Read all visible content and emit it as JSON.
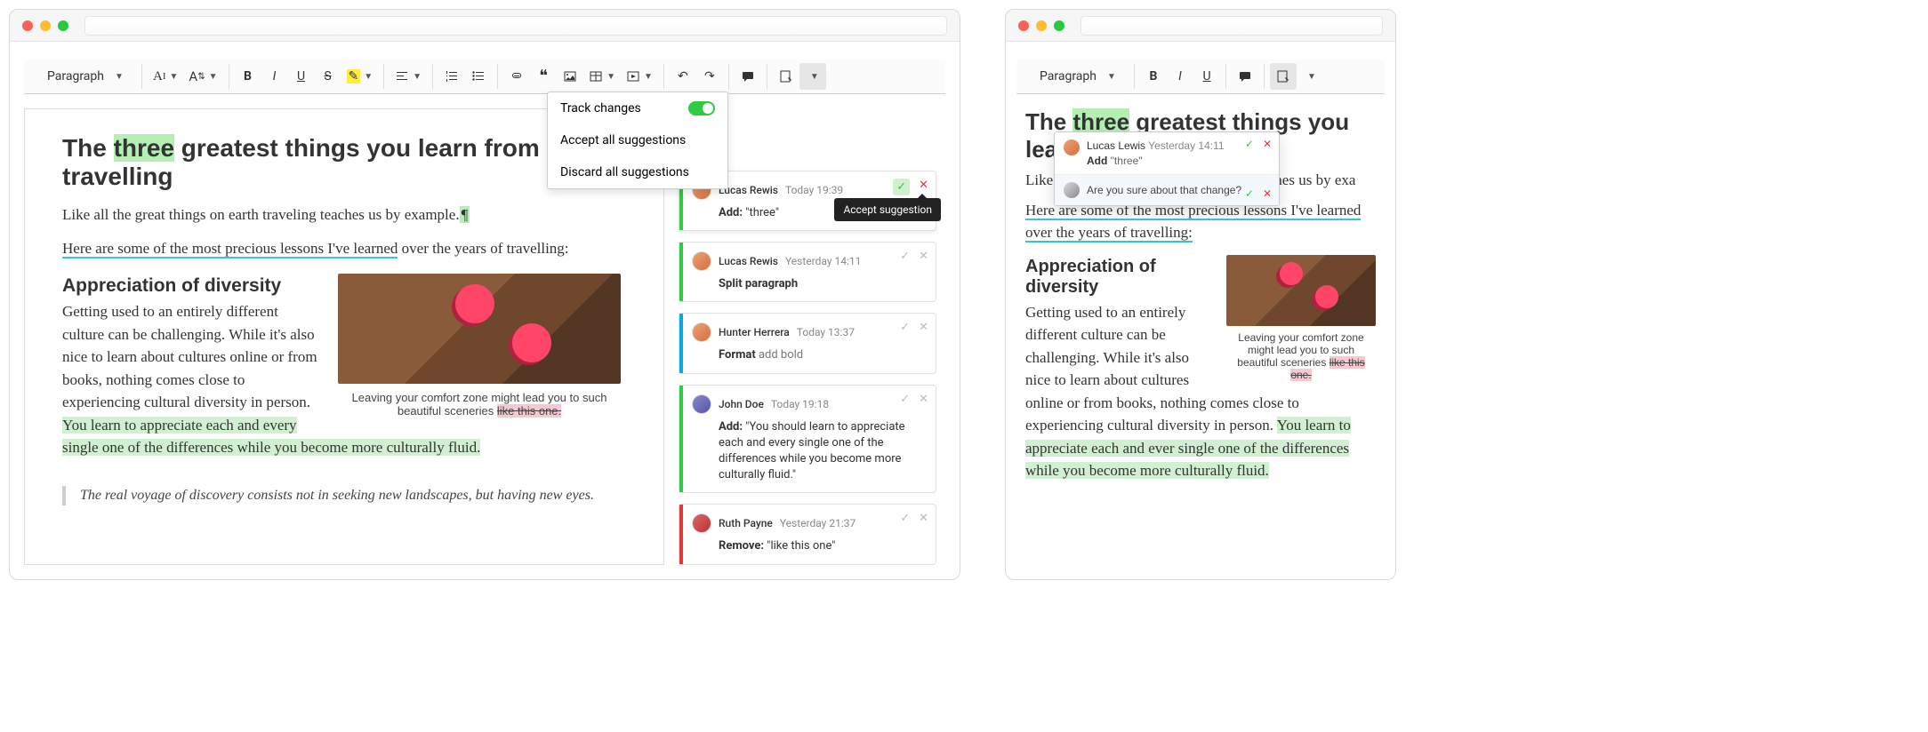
{
  "large": {
    "toolbar": {
      "paragraph_label": "Paragraph",
      "track_changes_menu": {
        "item1": "Track changes",
        "item2": "Accept all suggestions",
        "item3": "Discard all suggestions"
      }
    },
    "tooltip": "Accept suggestion",
    "page": {
      "title_pre": "The ",
      "title_ins": "three",
      "title_post": " greatest things you learn from travelling",
      "lede": "Like all the great things on earth traveling teaches us by example.",
      "fmt_line_pre": "Here are some of the most precious lessons I've learned",
      "fmt_line_post": " over the years of travelling:",
      "h2": "Appreciation of diversity",
      "body_pre": "Getting used to an entirely different culture can be challenging. While it's also nice to learn about cultures online or from books, nothing comes close to experiencing cultural diversity in person. ",
      "body_ins": "You learn to appreciate each and every single one of the differences while you become more culturally fluid.",
      "caption_pre": "Leaving your comfort zone might lead you to such beautiful sceneries ",
      "caption_del": "like this one.",
      "quote": "The real voyage of discovery consists not in seeking new landscapes, but having new eyes."
    },
    "suggestions": [
      {
        "kind": "add",
        "author": "Lucas Rewis",
        "ts": "Today 19:39",
        "label": "Add:",
        "text": "\"three\"",
        "active": true
      },
      {
        "kind": "add",
        "author": "Lucas Rewis",
        "ts": "Yesterday 14:11",
        "label": "Split paragraph",
        "text": ""
      },
      {
        "kind": "fmt",
        "author": "Hunter Herrera",
        "ts": "Today 13:37",
        "label": "Format",
        "text": "add bold"
      },
      {
        "kind": "add",
        "author": "John Doe",
        "ts": "Today 19:18",
        "label": "Add:",
        "text": "\"You should learn to appreciate each and every single one of the differences while you become more culturally fluid.\""
      },
      {
        "kind": "rmv",
        "author": "Ruth Payne",
        "ts": "Yesterday 21:37",
        "label": "Remove:",
        "text": "\"like this one\""
      }
    ]
  },
  "small": {
    "toolbar": {
      "paragraph_label": "Paragraph"
    },
    "page": {
      "title_pre": "The ",
      "title_ins": "three",
      "title_post": " greatest things you learn from",
      "lede_pre": "Like al",
      "lede_post": "eaches us by exa",
      "fmt_line": "Here are some of the most precious lessons I've learned over the years of travelling:",
      "h2": "Appreciation of diversity",
      "body_pre": "Getting used to an entirely different culture can be challenging. While it's also nice to learn about cultures online or from books, nothing comes close to experiencing cultural diversity in person. ",
      "body_ins": "You learn to appreciate each and ever single  one of the differences while you become more culturally fluid.",
      "caption_pre": "Leaving your comfort zone might lead you to such beautiful sceneries ",
      "caption_del": "like this one."
    },
    "popover": {
      "row1_author": "Lucas Lewis",
      "row1_ts": "Yesterday 14:11",
      "row1_label": "Add",
      "row1_text": "\"three\"",
      "row2_text": "Are you sure about that change?"
    }
  }
}
